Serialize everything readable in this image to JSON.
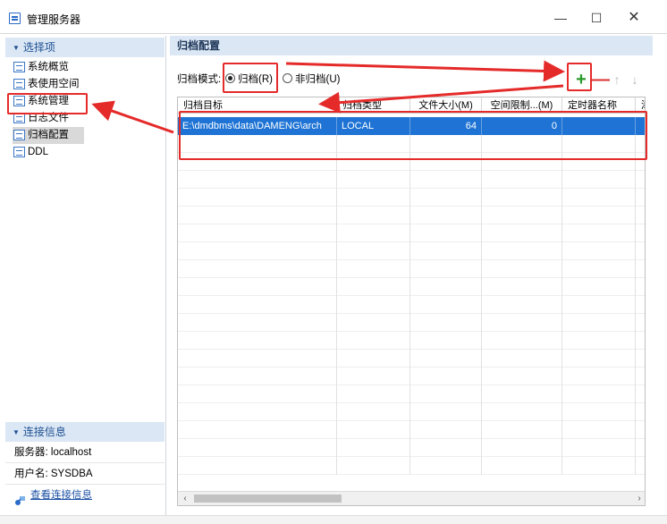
{
  "window": {
    "title": "管理服务器",
    "minimize_glyph": "—",
    "maximize_glyph": "☐",
    "close_glyph": "✕"
  },
  "sidebar": {
    "header": "选择项",
    "items": [
      {
        "label": "系统概览",
        "icon": "page-icon"
      },
      {
        "label": "表使用空间",
        "icon": "page-icon"
      },
      {
        "label": "系统管理",
        "icon": "page-icon"
      },
      {
        "label": "日志文件",
        "icon": "page-icon"
      },
      {
        "label": "归档配置",
        "icon": "page-icon",
        "selected": true
      },
      {
        "label": "DDL",
        "icon": "page-icon"
      }
    ]
  },
  "connection": {
    "header": "连接信息",
    "server": "服务器: localhost",
    "user": "用户名: SYSDBA",
    "link": "查看连接信息"
  },
  "main": {
    "title": "归档配置",
    "mode_label": "归档模式:",
    "radio_archive": "归档(R)",
    "radio_noarchive": "非归档(U)",
    "toolbar": {
      "add": "+",
      "remove": "—",
      "up": "↑",
      "down": "↓"
    },
    "columns": [
      "归档目标",
      "归档类型",
      "文件大小(M)",
      "空间限制...(M)",
      "定时器名称",
      "添"
    ],
    "rows": [
      {
        "target": "E:\\dmdbms\\data\\DAMENG\\arch",
        "type": "LOCAL",
        "size": "64",
        "limit": "0",
        "timer": "",
        "extra": ""
      }
    ],
    "scroll_left": "‹",
    "scroll_right": "›"
  },
  "colors": {
    "accent": "#1e73d4",
    "annotation": "#e52a2a",
    "add_green": "#2a9a2a",
    "remove_red": "#d83030"
  }
}
